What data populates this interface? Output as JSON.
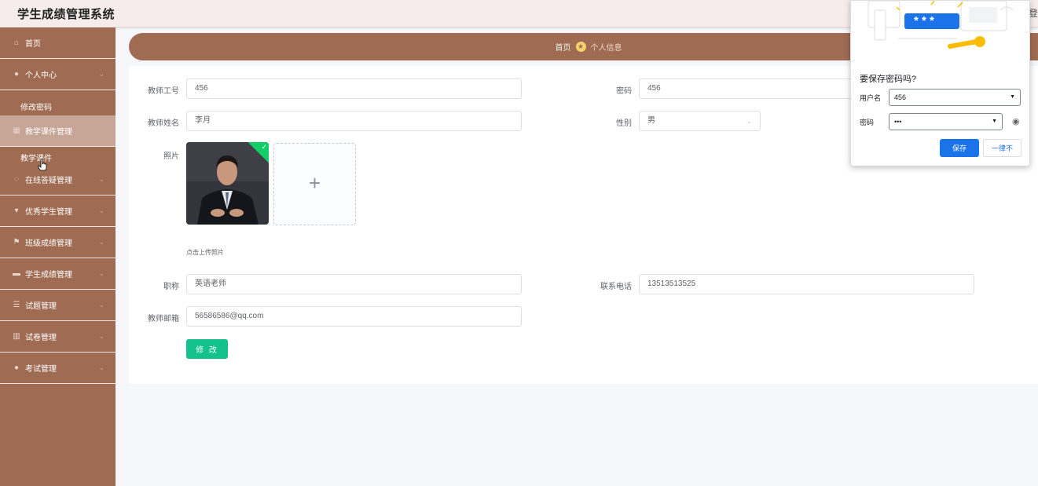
{
  "header": {
    "app_title": "学生成绩管理系统",
    "right_text": "登"
  },
  "sidebar": {
    "items": [
      {
        "label": "首页",
        "icon": "home-icon"
      },
      {
        "label": "个人中心",
        "icon": "user-icon"
      },
      {
        "label": "修改密码"
      },
      {
        "label": "教学课件管理",
        "icon": "grid-icon"
      },
      {
        "label": "教学课件"
      },
      {
        "label": "在线答疑管理",
        "icon": "chat-icon"
      },
      {
        "label": "优秀学生管理",
        "icon": "trophy-icon"
      },
      {
        "label": "班级成绩管理",
        "icon": "flag-icon"
      },
      {
        "label": "学生成绩管理",
        "icon": "monitor-icon"
      },
      {
        "label": "试题管理",
        "icon": "list-icon"
      },
      {
        "label": "试卷管理",
        "icon": "bar-chart-icon"
      },
      {
        "label": "考试管理",
        "icon": "user-icon"
      }
    ]
  },
  "breadcrumb": {
    "home": "首页",
    "current": "个人信息"
  },
  "form": {
    "teacher_id_label": "教师工号",
    "teacher_id_value": "456",
    "password_label": "密码",
    "password_value": "456",
    "teacher_name_label": "教师姓名",
    "teacher_name_value": "李月",
    "gender_label": "性别",
    "gender_value": "男",
    "photo_label": "照片",
    "upload_tip": "点击上传照片",
    "title_label": "职称",
    "title_value": "英语老师",
    "phone_label": "联系电话",
    "phone_value": "13513513525",
    "email_label": "教师邮箱",
    "email_value": "56586586@qq.com",
    "submit_label": "修 改"
  },
  "password_popup": {
    "illustration_text": "* * *",
    "title": "要保存密码吗?",
    "username_label": "用户名",
    "username_value": "456",
    "password_label": "密码",
    "password_value": "•••",
    "save_label": "保存",
    "never_label": "一律不"
  },
  "colors": {
    "sidebar_bg": "#a06b53",
    "active_item": "#c7a698",
    "submit_button": "#13c18e",
    "popup_primary": "#1a73e8"
  }
}
